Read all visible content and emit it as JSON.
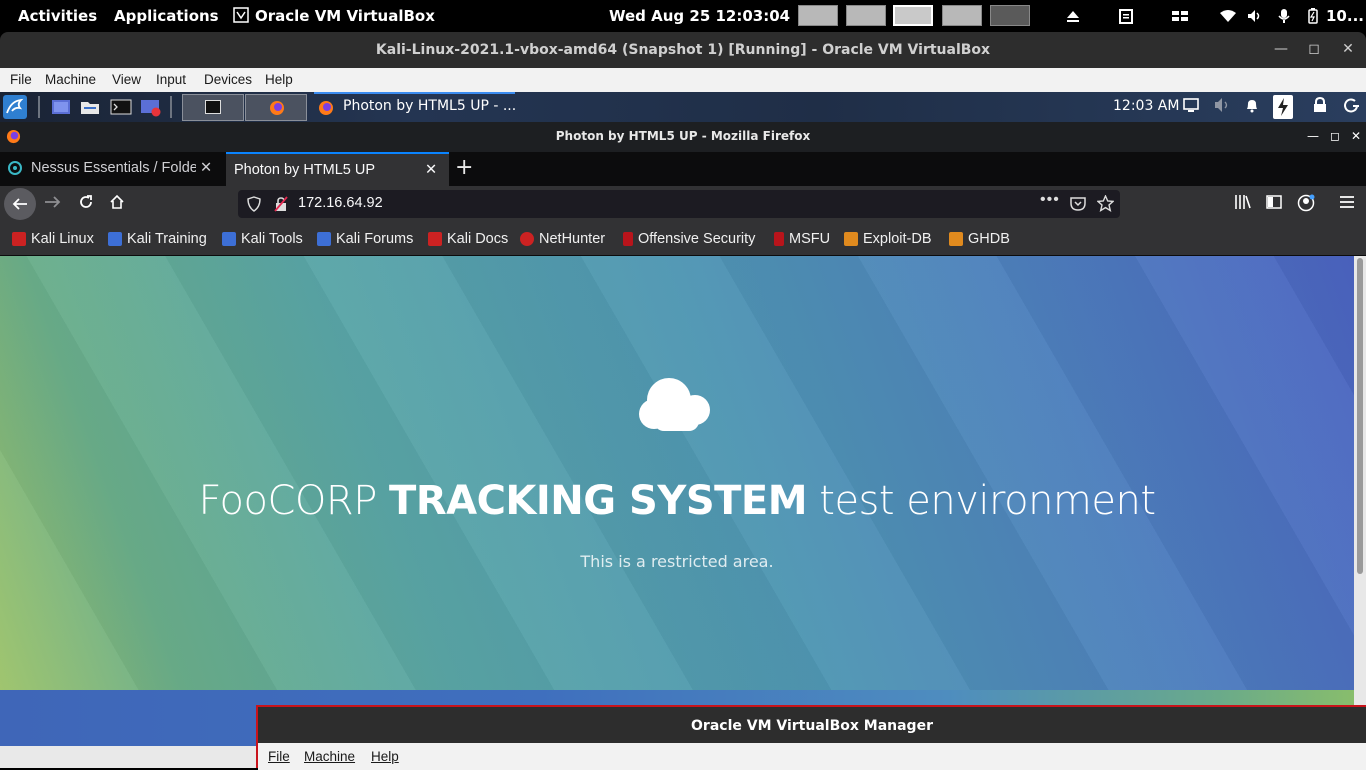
{
  "gnome": {
    "activities": "Activities",
    "applications": "Applications",
    "app_name": "Oracle VM VirtualBox",
    "clock": "Wed Aug 25  12:03:04",
    "battery": "10..."
  },
  "vbox_window": {
    "title": "Kali-Linux-2021.1-vbox-amd64 (Snapshot 1) [Running] - Oracle VM VirtualBox",
    "menu": [
      "File",
      "Machine",
      "View",
      "Input",
      "Devices",
      "Help"
    ]
  },
  "kali_panel": {
    "task_label": "Photon by HTML5 UP - ...",
    "clock": "12:03 AM"
  },
  "firefox": {
    "window_title": "Photon by HTML5 UP - Mozilla Firefox",
    "tabs": [
      {
        "label": "Nessus Essentials / Folde"
      },
      {
        "label": "Photon by HTML5 UP"
      }
    ],
    "url": "172.16.64.92",
    "bookmarks": [
      "Kali Linux",
      "Kali Training",
      "Kali Tools",
      "Kali Forums",
      "Kali Docs",
      "NetHunter",
      "Offensive Security",
      "MSFU",
      "Exploit-DB",
      "GHDB"
    ]
  },
  "page": {
    "headline_pre": "FooCORP ",
    "headline_bold": "TRACKING SYSTEM",
    "headline_post": " test environment",
    "subline": "This is a restricted area."
  },
  "vbox_manager": {
    "title": "Oracle VM VirtualBox Manager",
    "menu": [
      "File",
      "Machine",
      "Help"
    ]
  }
}
